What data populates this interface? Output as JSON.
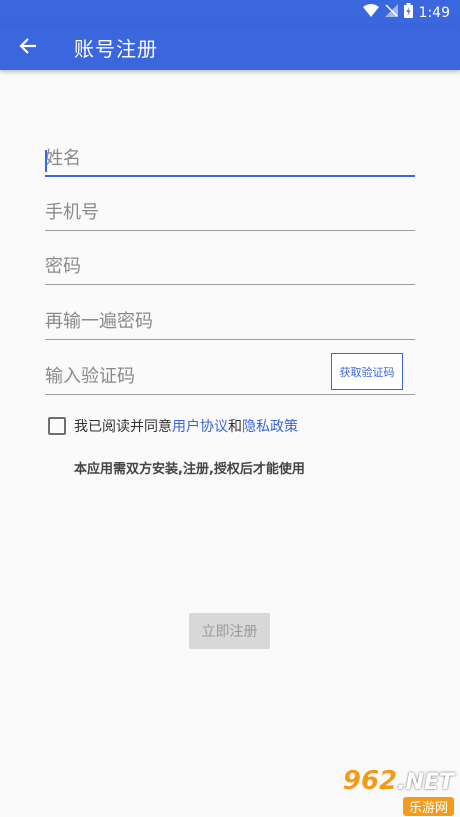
{
  "status_bar": {
    "time": "1:49",
    "icons": [
      "wifi-icon",
      "signal-icon",
      "battery-icon"
    ]
  },
  "app_bar": {
    "title": "账号注册",
    "back_icon": "arrow-left-icon"
  },
  "form": {
    "name_placeholder": "姓名",
    "phone_placeholder": "手机号",
    "password_placeholder": "密码",
    "confirm_password_placeholder": "再输一遍密码",
    "code_placeholder": "输入验证码",
    "get_code_label": "获取验证码"
  },
  "agreement": {
    "prefix": "我已阅读并同意",
    "user_agreement": "用户协议",
    "and": "和",
    "privacy_policy": "隐私政策",
    "checked": false
  },
  "notice": "本应用需双方安装,注册,授权后才能使用",
  "register_label": "立即注册",
  "watermark": {
    "top": "962",
    "net": ".NET",
    "bottom": "乐游网"
  },
  "colors": {
    "primary": "#3a66de",
    "background": "#fafafa",
    "disabled_button": "#d8d8d8"
  }
}
